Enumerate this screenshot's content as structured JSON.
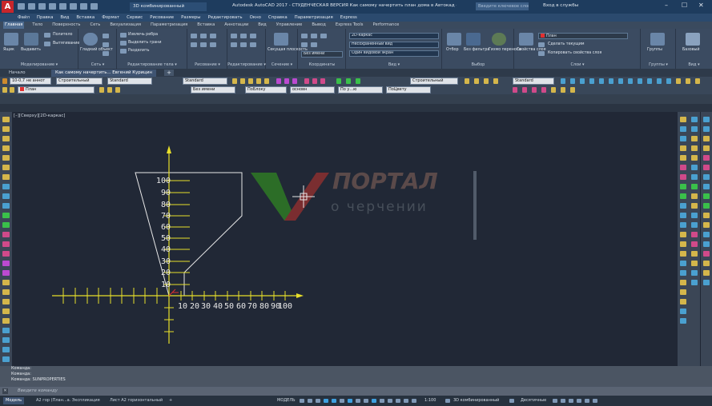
{
  "title_bar": {
    "app_letter": "A",
    "workspace": "3D комбинированный",
    "document_title": "Autodesk AutoCAD 2017 - СТУДЕНЧЕСКАЯ ВЕРСИЯ   Как самому начертить план дома в Автокад - Евгений Курицин.dwg",
    "search_placeholder": "Введите ключевое слово/фразу",
    "sign_in": "Вход в службы",
    "minimize": "–",
    "maximize": "☐",
    "close": "✕"
  },
  "menu": [
    "Файл",
    "Правка",
    "Вид",
    "Вставка",
    "Формат",
    "Сервис",
    "Рисование",
    "Размеры",
    "Редактировать",
    "Окно",
    "Справка",
    "Параметризация",
    "Express"
  ],
  "ribbon_tabs": [
    "Главная",
    "Тело",
    "Поверхность",
    "Сеть",
    "Визуализация",
    "Параметризация",
    "Вставка",
    "Аннотации",
    "Вид",
    "Управление",
    "Вывод",
    "Express Tools",
    "Performance"
  ],
  "ribbon_tabs_active": "Главная",
  "ribbon": {
    "tools": {
      "box": "Ящик",
      "extrude": "Выдавить",
      "polysolid": "Политело",
      "presspull": "Вытягивание",
      "smooth_object": "Гладкий объект",
      "extract_edges": "Извлечь ребра",
      "extract_faces": "Выделить грани",
      "separate": "Разделить",
      "section_plane": "Секущая плоскость",
      "no_filter": "Без фильтра",
      "gizmo": "Гизмо переноса",
      "layer_props": "Свойства слоя",
      "make_current": "Сделать текущим",
      "copy_layer_props": "Копировать свойства слоя",
      "groups": "Группы",
      "base": "Базовый",
      "select": "Отбор"
    },
    "combos": {
      "visual_style": "2D-каркас",
      "unsaved_view": "Несохраненный вид",
      "one_viewport": "Один видовой экран",
      "layer": "План",
      "without_name": "Без имени"
    },
    "footers": [
      "Моделирование ▾",
      "Сеть ▾",
      "Редактирование тела ▾",
      "Рисование ▾",
      "Редактирование ▾",
      "Сечение ▾",
      "Координаты",
      "Вид ▾",
      "Выбор",
      "Слои ▾",
      "Группы ▾",
      "Вид ▾"
    ]
  },
  "doc_tabs": {
    "start": "Начало",
    "active": "Как самому начертить... Евгений Курицин",
    "new_tab": "+"
  },
  "toolbar_row1": {
    "annotative": "10-0,7 не аннот",
    "style1": "Строительный",
    "standard1": "Standard",
    "standard2": "Standard",
    "style2": "Строительный",
    "standard3": "Standard"
  },
  "toolbar_row2": {
    "layer": "План",
    "without_name": "Без имени",
    "by_layer": "ПоБлоку",
    "osnovn": "основн",
    "by_layer2": "По у...ю",
    "weight_label": "ПоЦвету"
  },
  "viewport_label": "[–][Сверху][2D-каркас]",
  "axis_labels_y": [
    "100",
    "90",
    "80",
    "70",
    "60",
    "50",
    "40",
    "30",
    "20",
    "10"
  ],
  "axis_labels_x": [
    "10",
    "20",
    "30",
    "40",
    "50",
    "60",
    "70",
    "80",
    "90",
    "100"
  ],
  "watermark": {
    "line1": "ПОРТАЛ",
    "line2": "о черчении"
  },
  "command_history": [
    "Команда:",
    "Команда:",
    "Команда: SUNPROPERTIES"
  ],
  "command_placeholder": "Введите команду",
  "status": {
    "tabs": [
      "Модель",
      "A2 гор (План...а. Экспликация",
      "Лист A2 горизонтальный"
    ],
    "active_tab": "Модель",
    "add_tab": "+",
    "model_label": "МОДЕЛЬ",
    "scale": "1:100",
    "workspace": "3D комбинированный",
    "units": "Десятичные"
  },
  "colors": {
    "accent_red": "#e23030",
    "axis_yellow": "#e8df2a",
    "triangle_white": "#e8e8e8",
    "watermark_green": "#3a8a2a",
    "watermark_red": "#a33a3a"
  }
}
